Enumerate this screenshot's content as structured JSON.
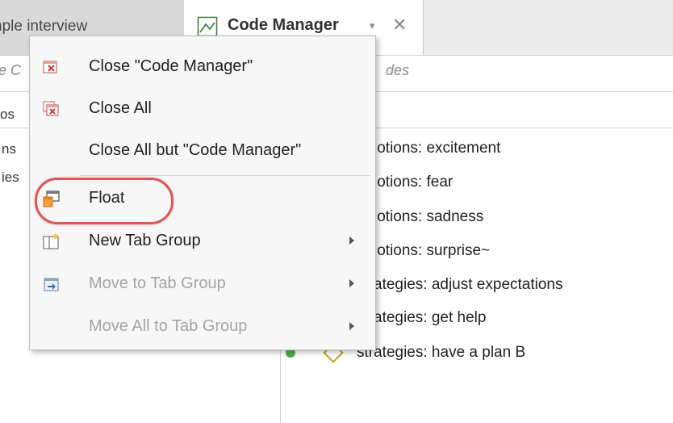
{
  "tabs": {
    "inactive_label": "nple interview",
    "active_label": "Code Manager",
    "dropdown_glyph": "▾",
    "close_glyph": "✕"
  },
  "search": {
    "left_text": "e C",
    "right_text": "des"
  },
  "left_pane": {
    "header": "os",
    "items": [
      "ns",
      "ies"
    ]
  },
  "codes": [
    "lotions: excitement",
    "lotions: fear",
    "lotions: sadness",
    "lotions: surprise~",
    "ategies: adjust expectations",
    "ategies: get help",
    "strategies: have a plan B"
  ],
  "context_menu": {
    "close_current": "Close \"Code Manager\"",
    "close_all": "Close All",
    "close_all_but": "Close All but \"Code Manager\"",
    "float": "Float",
    "new_tab_group": "New Tab Group",
    "move_to_tab_group": "Move to Tab Group",
    "move_all_to_tab_group": "Move All to Tab Group"
  },
  "colors": {
    "highlight_ring": "#e05456",
    "disabled_text": "#a5a5a5",
    "code_status_green": "#4caf50",
    "code_diamond_gold": "#c9a227"
  },
  "icons": {
    "tab": "code-manager-tab-icon",
    "close_current": "close-window-icon",
    "close_all": "close-all-icon",
    "float": "float-window-icon",
    "new_tab_group": "new-tab-group-icon",
    "move_to_tab_group": "move-to-tab-group-icon"
  }
}
